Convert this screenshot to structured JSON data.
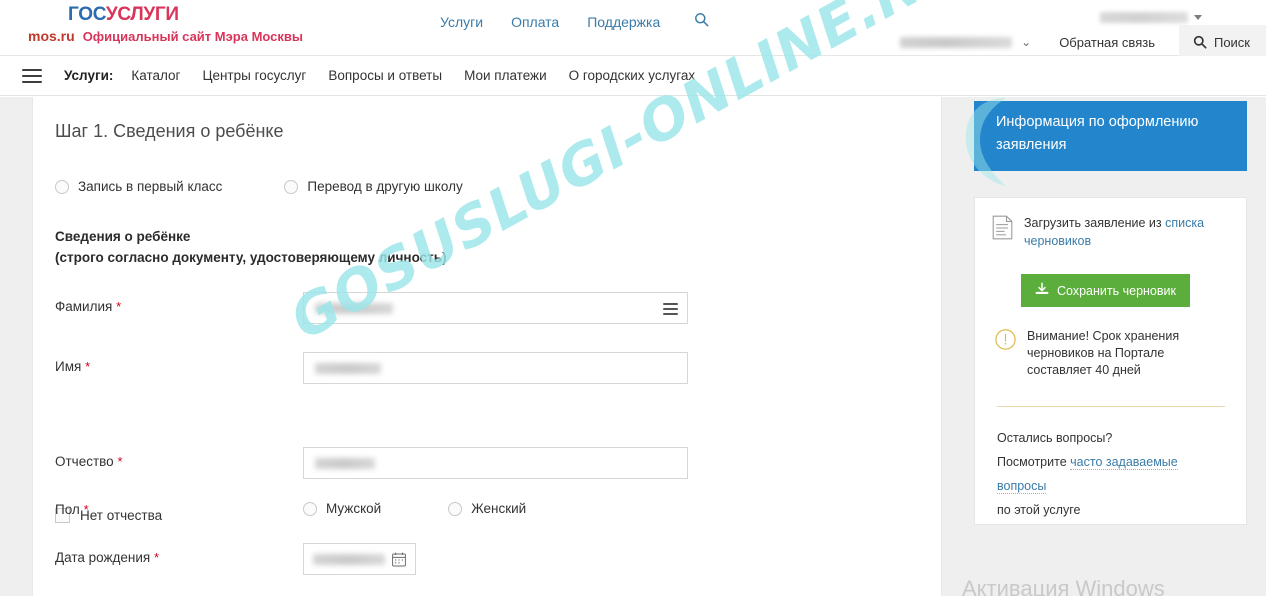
{
  "brand": {
    "logo_gos": "ГОС",
    "logo_uslugi": "УСЛУГИ",
    "mos": "mos.ru",
    "subtitle": "Официальный сайт Мэра Москвы",
    "colors": {
      "gos_blue": "#2b6cb0",
      "uslugi_red": "#d9355b",
      "mos_red": "#c0392b"
    }
  },
  "topnav": {
    "items": [
      {
        "label": "Услуги"
      },
      {
        "label": "Оплата"
      },
      {
        "label": "Поддержка"
      }
    ],
    "search_icon": "search-icon",
    "feedback": "Обратная связь",
    "search_button": "Поиск",
    "account_caret": "▾"
  },
  "mainnav": {
    "menu_icon": "hamburger-icon",
    "label": "Услуги:",
    "items": [
      {
        "label": "Каталог"
      },
      {
        "label": "Центры госуслуг"
      },
      {
        "label": "Вопросы и ответы"
      },
      {
        "label": "Мои платежи"
      },
      {
        "label": "О городских услугах"
      }
    ]
  },
  "form": {
    "step_title": "Шаг 1. Сведения о ребёнке",
    "type_options": [
      {
        "label": "Запись в первый класс",
        "selected": false
      },
      {
        "label": "Перевод в другую школу",
        "selected": false
      }
    ],
    "section_heading_line1": "Сведения о ребёнке",
    "section_heading_line2": "(строго согласно документу, удостоверяющему личность)",
    "required_mark": "*",
    "fields": [
      {
        "label": "Фамилия",
        "required": true,
        "value": "",
        "icon": "list-icon"
      },
      {
        "label": "Имя",
        "required": true,
        "value": ""
      },
      {
        "label": "Отчество",
        "required": true,
        "value": ""
      }
    ],
    "no_patronymic": {
      "label": "Нет отчества",
      "checked": false
    },
    "gender": {
      "label": "Пол",
      "required": true,
      "options": [
        {
          "label": "Мужской",
          "selected": false
        },
        {
          "label": "Женский",
          "selected": false
        }
      ]
    },
    "birthdate": {
      "label": "Дата рождения",
      "required": true,
      "value": "",
      "icon": "calendar-icon"
    }
  },
  "sidebar": {
    "info_banner": "Информация по оформлению заявления",
    "info_banner_color": "#2386cd",
    "upload": {
      "icon": "document-icon",
      "text_before": "Загрузить заявление из ",
      "link_text": "списка черновиков"
    },
    "save_draft": {
      "label": "Сохранить черновик",
      "icon": "download-icon",
      "color": "#5cae3c"
    },
    "warning": {
      "icon": "exclamation-circle-icon",
      "text": "Внимание! Срок хранения черновиков на Портале составляет 40 дней"
    },
    "faq": {
      "line1": "Остались вопросы?",
      "line2_before": "Посмотрите ",
      "link_text": "часто задаваемые вопросы",
      "line3": "по этой услуге"
    }
  },
  "watermarks": {
    "site": "GOSUSLUGI-ONLINE.RU",
    "site_color": "#9ce6ea",
    "windows": "Активация Windows"
  }
}
